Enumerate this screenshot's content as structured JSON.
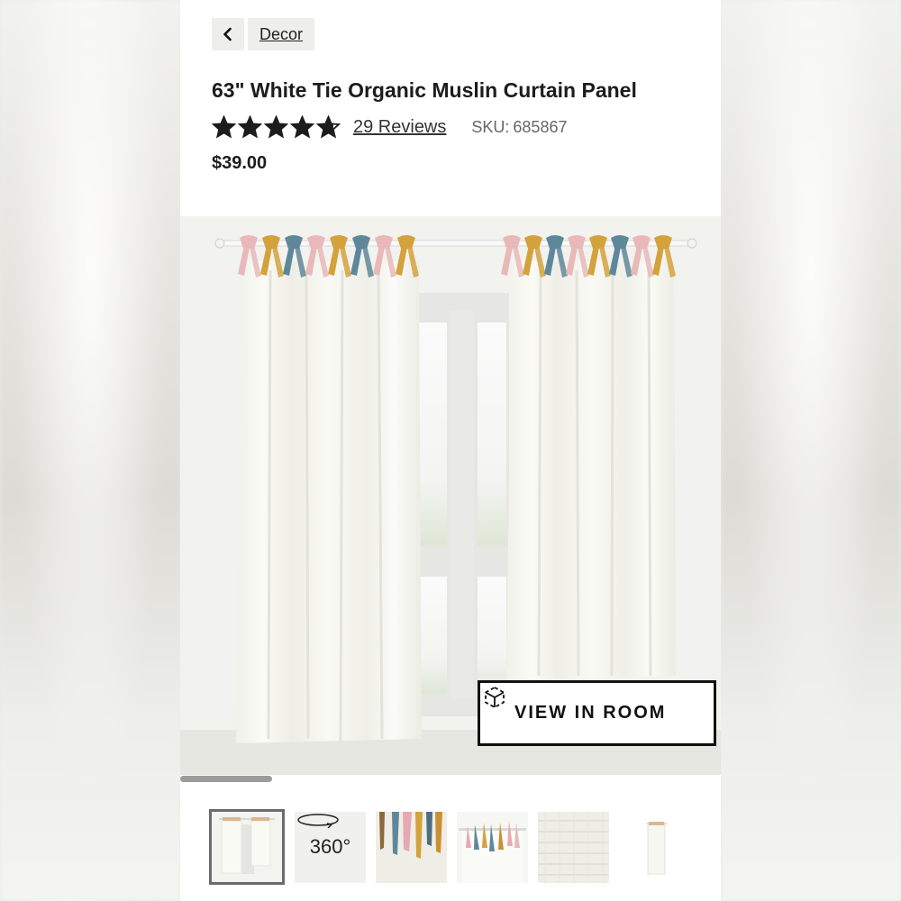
{
  "breadcrumb": {
    "back_icon": "chevron-left-icon",
    "label": "Decor"
  },
  "product": {
    "title": "63\" White Tie Organic Muslin Curtain Panel",
    "rating": 4.7,
    "rating_max": 5,
    "reviews_label": "29 Reviews",
    "sku_label": "SKU:",
    "sku_value": "685867",
    "price": "$39.00"
  },
  "gallery": {
    "view_in_room_label": "VIEW IN ROOM",
    "view_in_room_icon": "ar-cube-icon",
    "scroll_progress": 0.17,
    "thumbnails": [
      {
        "kind": "curtain-pair",
        "active": true
      },
      {
        "kind": "360",
        "label": "360°",
        "icon": "rotate-360-icon"
      },
      {
        "kind": "ties-closeup"
      },
      {
        "kind": "rod-ties"
      },
      {
        "kind": "fabric-texture"
      },
      {
        "kind": "single-panel"
      }
    ]
  },
  "colors": {
    "text": "#1c1c1c",
    "tie_pink": "#e9b9b9",
    "tie_gold": "#d4a23c",
    "tie_blue": "#5f879a",
    "curtain": "#f7f7f1"
  }
}
